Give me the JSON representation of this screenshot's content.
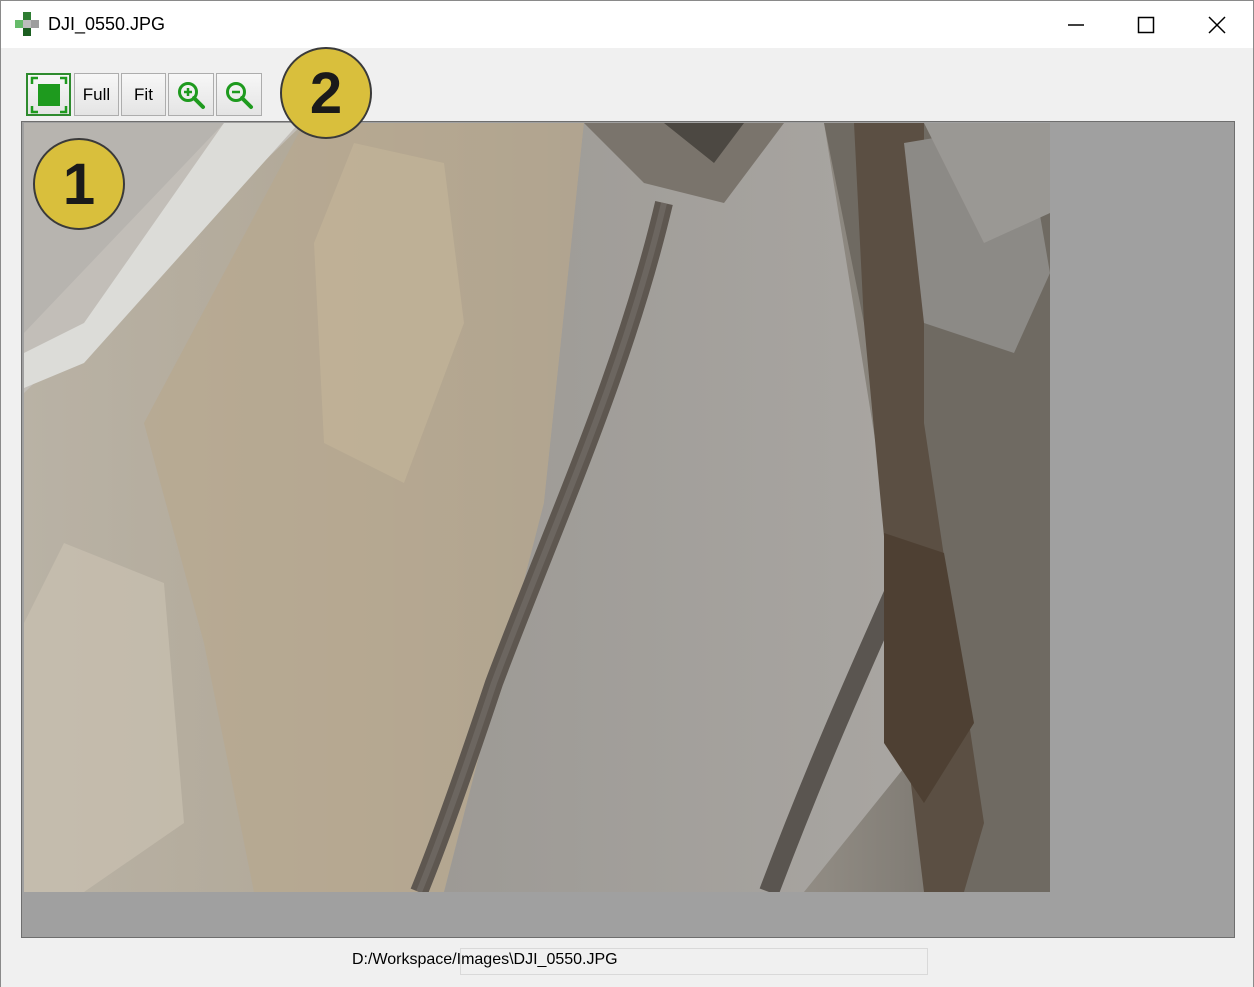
{
  "window": {
    "title": "DJI_0550.JPG",
    "controls": {
      "minimize": "minimize-icon",
      "maximize": "maximize-icon",
      "close": "close-icon"
    }
  },
  "toolbar": {
    "fit_window_icon": "fit-window-icon",
    "full_label": "Full",
    "fit_label": "Fit",
    "zoom_in_icon": "zoom-in-icon",
    "zoom_out_icon": "zoom-out-icon"
  },
  "callouts": {
    "one": "1",
    "two": "2"
  },
  "status": {
    "file_path": "D:/Workspace/Images\\DJI_0550.JPG"
  },
  "colors": {
    "accent_green": "#1e9a1e",
    "callout_yellow": "#d9bf3c",
    "viewport_gray": "#a0a0a0"
  }
}
